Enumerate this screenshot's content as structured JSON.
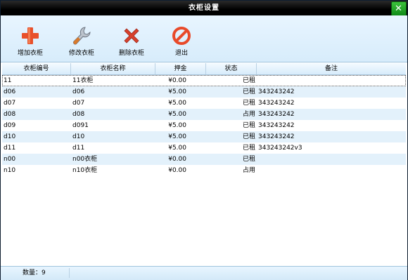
{
  "window": {
    "title": "衣柜设置",
    "close_glyph": "✕"
  },
  "toolbar": {
    "buttons": [
      {
        "label": "增加衣柜",
        "icon": "plus-icon",
        "color": "#e8502a"
      },
      {
        "label": "修改衣柜",
        "icon": "wrench-icon",
        "color": "#d87a2c"
      },
      {
        "label": "删除衣柜",
        "icon": "delete-x-icon",
        "color": "#d8402c"
      },
      {
        "label": "退出",
        "icon": "no-entry-icon",
        "color": "#e84a2a"
      }
    ]
  },
  "table": {
    "columns": [
      "衣柜编号",
      "衣柜名称",
      "押金",
      "状态",
      "备注"
    ],
    "rows": [
      {
        "id": "11",
        "name": "11衣柜",
        "deposit": "¥0.00",
        "status": "已租",
        "note": ""
      },
      {
        "id": "d06",
        "name": "d06",
        "deposit": "¥5.00",
        "status": "已租",
        "note": "343243242"
      },
      {
        "id": "d07",
        "name": "d07",
        "deposit": "¥5.00",
        "status": "已租",
        "note": "343243242"
      },
      {
        "id": "d08",
        "name": "d08",
        "deposit": "¥5.00",
        "status": "占用",
        "note": "343243242"
      },
      {
        "id": "d09",
        "name": "d091",
        "deposit": "¥5.00",
        "status": "已租",
        "note": "343243242"
      },
      {
        "id": "d10",
        "name": "d10",
        "deposit": "¥5.00",
        "status": "已租",
        "note": "343243242"
      },
      {
        "id": "d11",
        "name": "d11",
        "deposit": "¥5.00",
        "status": "已租",
        "note": "343243242v3"
      },
      {
        "id": "n00",
        "name": "n00衣柜",
        "deposit": "¥0.00",
        "status": "已租",
        "note": ""
      },
      {
        "id": "n10",
        "name": "n10衣柜",
        "deposit": "¥0.00",
        "status": "占用",
        "note": ""
      }
    ]
  },
  "statusbar": {
    "count_label": "数量：9"
  },
  "colors": {
    "titlebar": "#000000",
    "accent": "#d7ecfb",
    "row_alt": "#e3f1fb",
    "close": "#1aa31f"
  }
}
